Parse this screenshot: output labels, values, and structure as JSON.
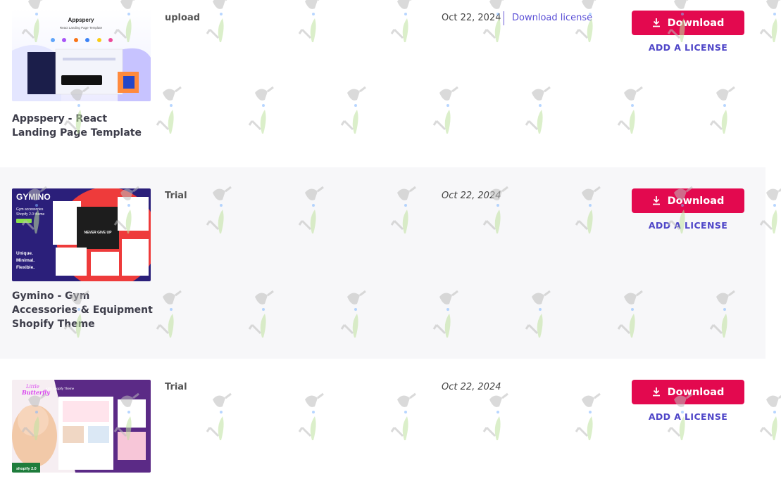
{
  "items": [
    {
      "title": "Appspery - React Landing Page Template",
      "license_type": "upload",
      "date": "Oct 22, 2024",
      "download_license_label": "Download license",
      "download_label": "Download",
      "add_license_label": "ADD A LICENSE",
      "thumb": {
        "brand": "Appspery",
        "subtitle": "React Landing Page Template"
      }
    },
    {
      "title": "Gymino - Gym Accessories & Equipment Shopify Theme",
      "license_type": "Trial",
      "date": "Oct 22, 2024",
      "download_label": "Download",
      "add_license_label": "ADD A LICENSE",
      "thumb": {
        "brand": "GYMINO",
        "line1": "Gym accessories",
        "line2": "Shopify 2.0 theme",
        "tag1": "Unique.",
        "tag2": "Minimal.",
        "tag3": "Flexible.",
        "promo": "NEVER GIVE UP"
      }
    },
    {
      "title": "",
      "license_type": "Trial",
      "date": "Oct 22, 2024",
      "download_label": "Download",
      "add_license_label": "ADD A LICENSE",
      "thumb": {
        "brand1": "Little",
        "brand2": "Butterfly",
        "subtitle": "Kids Shopify Theme",
        "badge": "shopify 2.0"
      }
    }
  ],
  "colors": {
    "download_button": "#e3094f",
    "link": "#5a4fd6",
    "alt_row": "#f7f7f9"
  }
}
